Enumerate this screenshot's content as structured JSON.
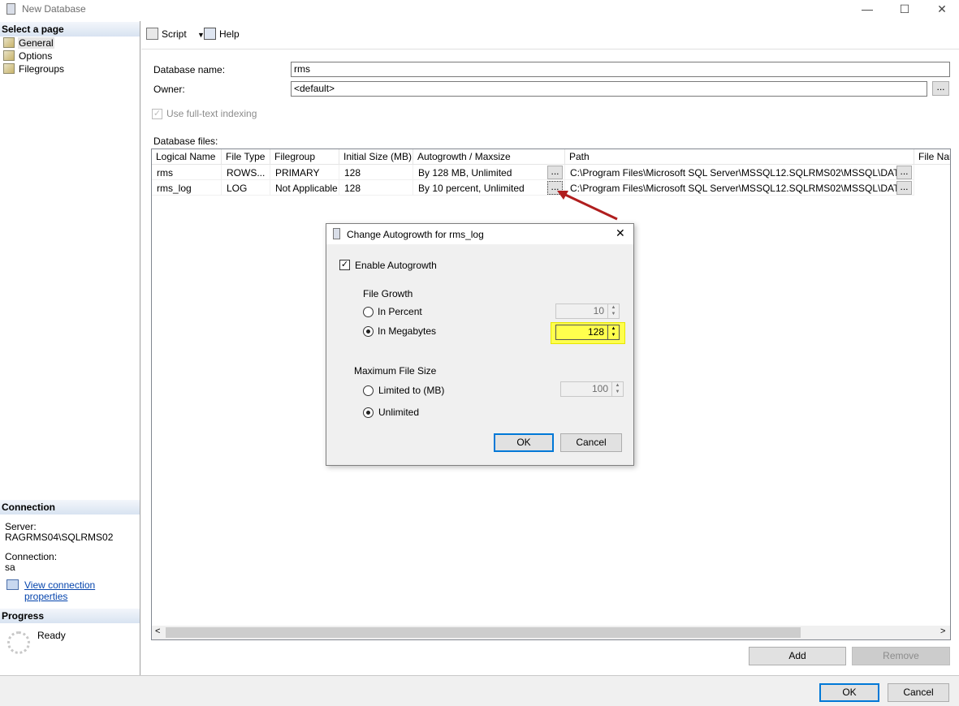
{
  "window": {
    "title": "New Database",
    "minimize": "—",
    "maximize": "☐",
    "close": "✕"
  },
  "left": {
    "select_page_header": "Select a page",
    "pages": [
      {
        "label": "General"
      },
      {
        "label": "Options"
      },
      {
        "label": "Filegroups"
      }
    ],
    "connection_header": "Connection",
    "server_label": "Server:",
    "server_value": "RAGRMS04\\SQLRMS02",
    "connection_label": "Connection:",
    "connection_value": "sa",
    "view_connection_link": "View connection properties",
    "progress_header": "Progress",
    "progress_status": "Ready"
  },
  "toolbar": {
    "script_label": "Script",
    "help_label": "Help"
  },
  "form": {
    "db_name_label": "Database name:",
    "db_name_value": "rms",
    "owner_label": "Owner:",
    "owner_value": "<default>",
    "fulltext_label": "Use full-text indexing",
    "db_files_label": "Database files:"
  },
  "grid": {
    "columns": [
      "Logical Name",
      "File Type",
      "Filegroup",
      "Initial Size (MB)",
      "Autogrowth / Maxsize",
      "Path",
      "File Nam"
    ],
    "rows": [
      {
        "name": "rms",
        "type": "ROWS...",
        "filegroup": "PRIMARY",
        "size": "128",
        "autogrowth": "By 128 MB, Unlimited",
        "path": "C:\\Program Files\\Microsoft SQL Server\\MSSQL12.SQLRMS02\\MSSQL\\DATA\\"
      },
      {
        "name": "rms_log",
        "type": "LOG",
        "filegroup": "Not Applicable",
        "size": "128",
        "autogrowth": "By 10 percent, Unlimited",
        "path": "C:\\Program Files\\Microsoft SQL Server\\MSSQL12.SQLRMS02\\MSSQL\\DATA\\"
      }
    ],
    "ellipsis": "..."
  },
  "buttons": {
    "add": "Add",
    "remove": "Remove",
    "ok": "OK",
    "cancel": "Cancel"
  },
  "dialog": {
    "title": "Change Autogrowth for rms_log",
    "enable_autogrowth": "Enable Autogrowth",
    "file_growth_label": "File Growth",
    "in_percent": "In Percent",
    "percent_value": "10",
    "in_megabytes": "In Megabytes",
    "megabytes_value": "128",
    "max_file_size_label": "Maximum File Size",
    "limited_to": "Limited to (MB)",
    "limited_value": "100",
    "unlimited": "Unlimited",
    "ok": "OK",
    "cancel": "Cancel"
  },
  "colors": {
    "highlight": "#ffff4d",
    "arrow": "#b01e1e",
    "accent": "#0078d7"
  }
}
